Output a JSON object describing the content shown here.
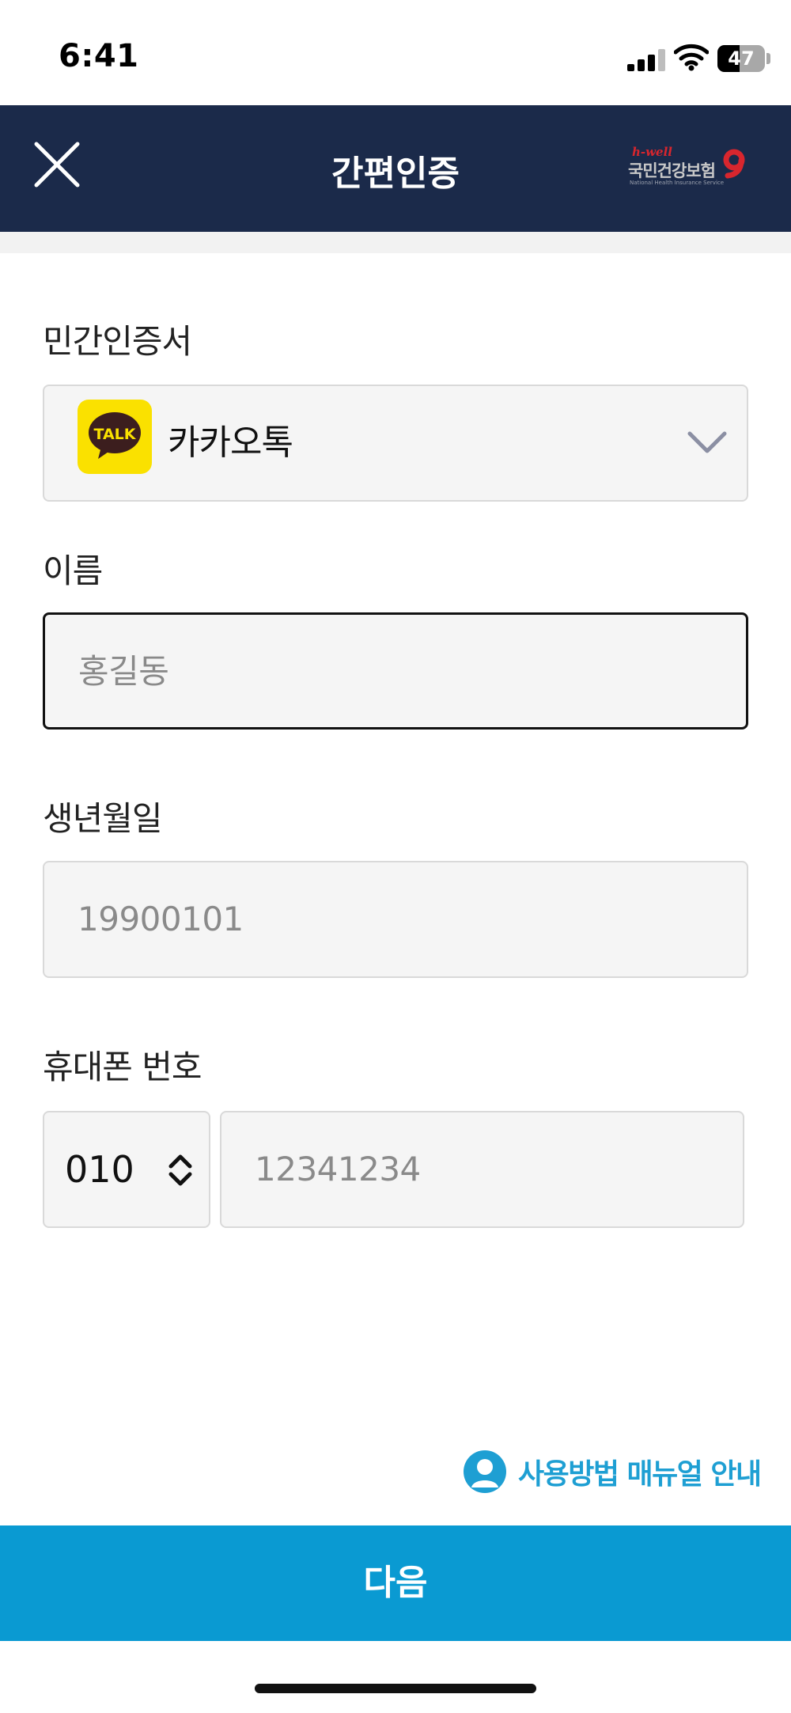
{
  "status_bar": {
    "time": "6:41",
    "battery": "47",
    "battery_level": 0.47
  },
  "header": {
    "title": "간편인증",
    "brand": {
      "tagline": "h-well",
      "name": "국민건강보험",
      "subtitle": "National Health Insurance Service"
    }
  },
  "form": {
    "certificate": {
      "label": "민간인증서",
      "selected": "카카오톡",
      "icon_text": "TALK",
      "icon": "kakaotalk-icon"
    },
    "name": {
      "label": "이름",
      "placeholder": "홍길동"
    },
    "birth": {
      "label": "생년월일",
      "placeholder": "19900101"
    },
    "phone": {
      "label": "휴대폰 번호",
      "prefix": "010",
      "placeholder": "12341234"
    }
  },
  "manual_link": "사용방법 매뉴얼 안내",
  "next_button": "다음",
  "colors": {
    "header_bg": "#1b2a4a",
    "accent": "#0a9ad2",
    "kakao": "#fae100",
    "link": "#1e9fd3"
  }
}
